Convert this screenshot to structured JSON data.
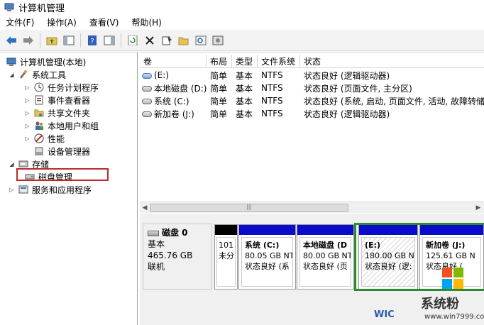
{
  "window": {
    "title": "计算机管理"
  },
  "menu": [
    "文件(F)",
    "操作(A)",
    "查看(V)",
    "帮助(H)"
  ],
  "tree": {
    "root": "计算机管理(本地)",
    "system_tools": "系统工具",
    "task_scheduler": "任务计划程序",
    "event_viewer": "事件查看器",
    "shared_folders": "共享文件夹",
    "local_users": "本地用户和组",
    "performance": "性能",
    "device_manager": "设备管理器",
    "storage": "存储",
    "disk_management": "磁盘管理",
    "services_apps": "服务和应用程序"
  },
  "columns": [
    "卷",
    "布局",
    "类型",
    "文件系统",
    "状态"
  ],
  "volumes": [
    {
      "name": "(E:)",
      "layout": "简单",
      "type": "基本",
      "fs": "NTFS",
      "status": "状态良好 (逻辑驱动器)"
    },
    {
      "name": "本地磁盘 (D:)",
      "layout": "简单",
      "type": "基本",
      "fs": "NTFS",
      "status": "状态良好 (页面文件, 主分区)"
    },
    {
      "name": "系统 (C:)",
      "layout": "简单",
      "type": "基本",
      "fs": "NTFS",
      "status": "状态良好 (系统, 启动, 页面文件, 活动, 故障转储,"
    },
    {
      "name": "新加卷 (J:)",
      "layout": "简单",
      "type": "基本",
      "fs": "NTFS",
      "status": "状态良好 (逻辑驱动器)"
    }
  ],
  "disk": {
    "name": "磁盘 0",
    "type": "基本",
    "size": "465.76 GB",
    "status": "联机"
  },
  "partitions": [
    {
      "name": "",
      "size": "101",
      "status": "未分"
    },
    {
      "name": "系统 (C:)",
      "size": "80.05 GB NTF",
      "status": "状态良好 (系"
    },
    {
      "name": "本地磁盘 (D",
      "size": "80.00 GB NTF",
      "status": "状态良好 (页"
    },
    {
      "name": "(E:)",
      "size": "180.00 GB NT",
      "status": "状态良好 (逻:"
    },
    {
      "name": "新加卷 (J:)",
      "size": "125.61 GB N",
      "status": "状态良好 ("
    }
  ],
  "watermark": {
    "brand": "系统粉",
    "url": "www.win7999.com",
    "win": "WIC"
  },
  "colors": {
    "primary_bar": "#000000",
    "logical_bar": "#0b0bcc",
    "selection": "#2e8b2e",
    "highlight": "#c0282e"
  }
}
